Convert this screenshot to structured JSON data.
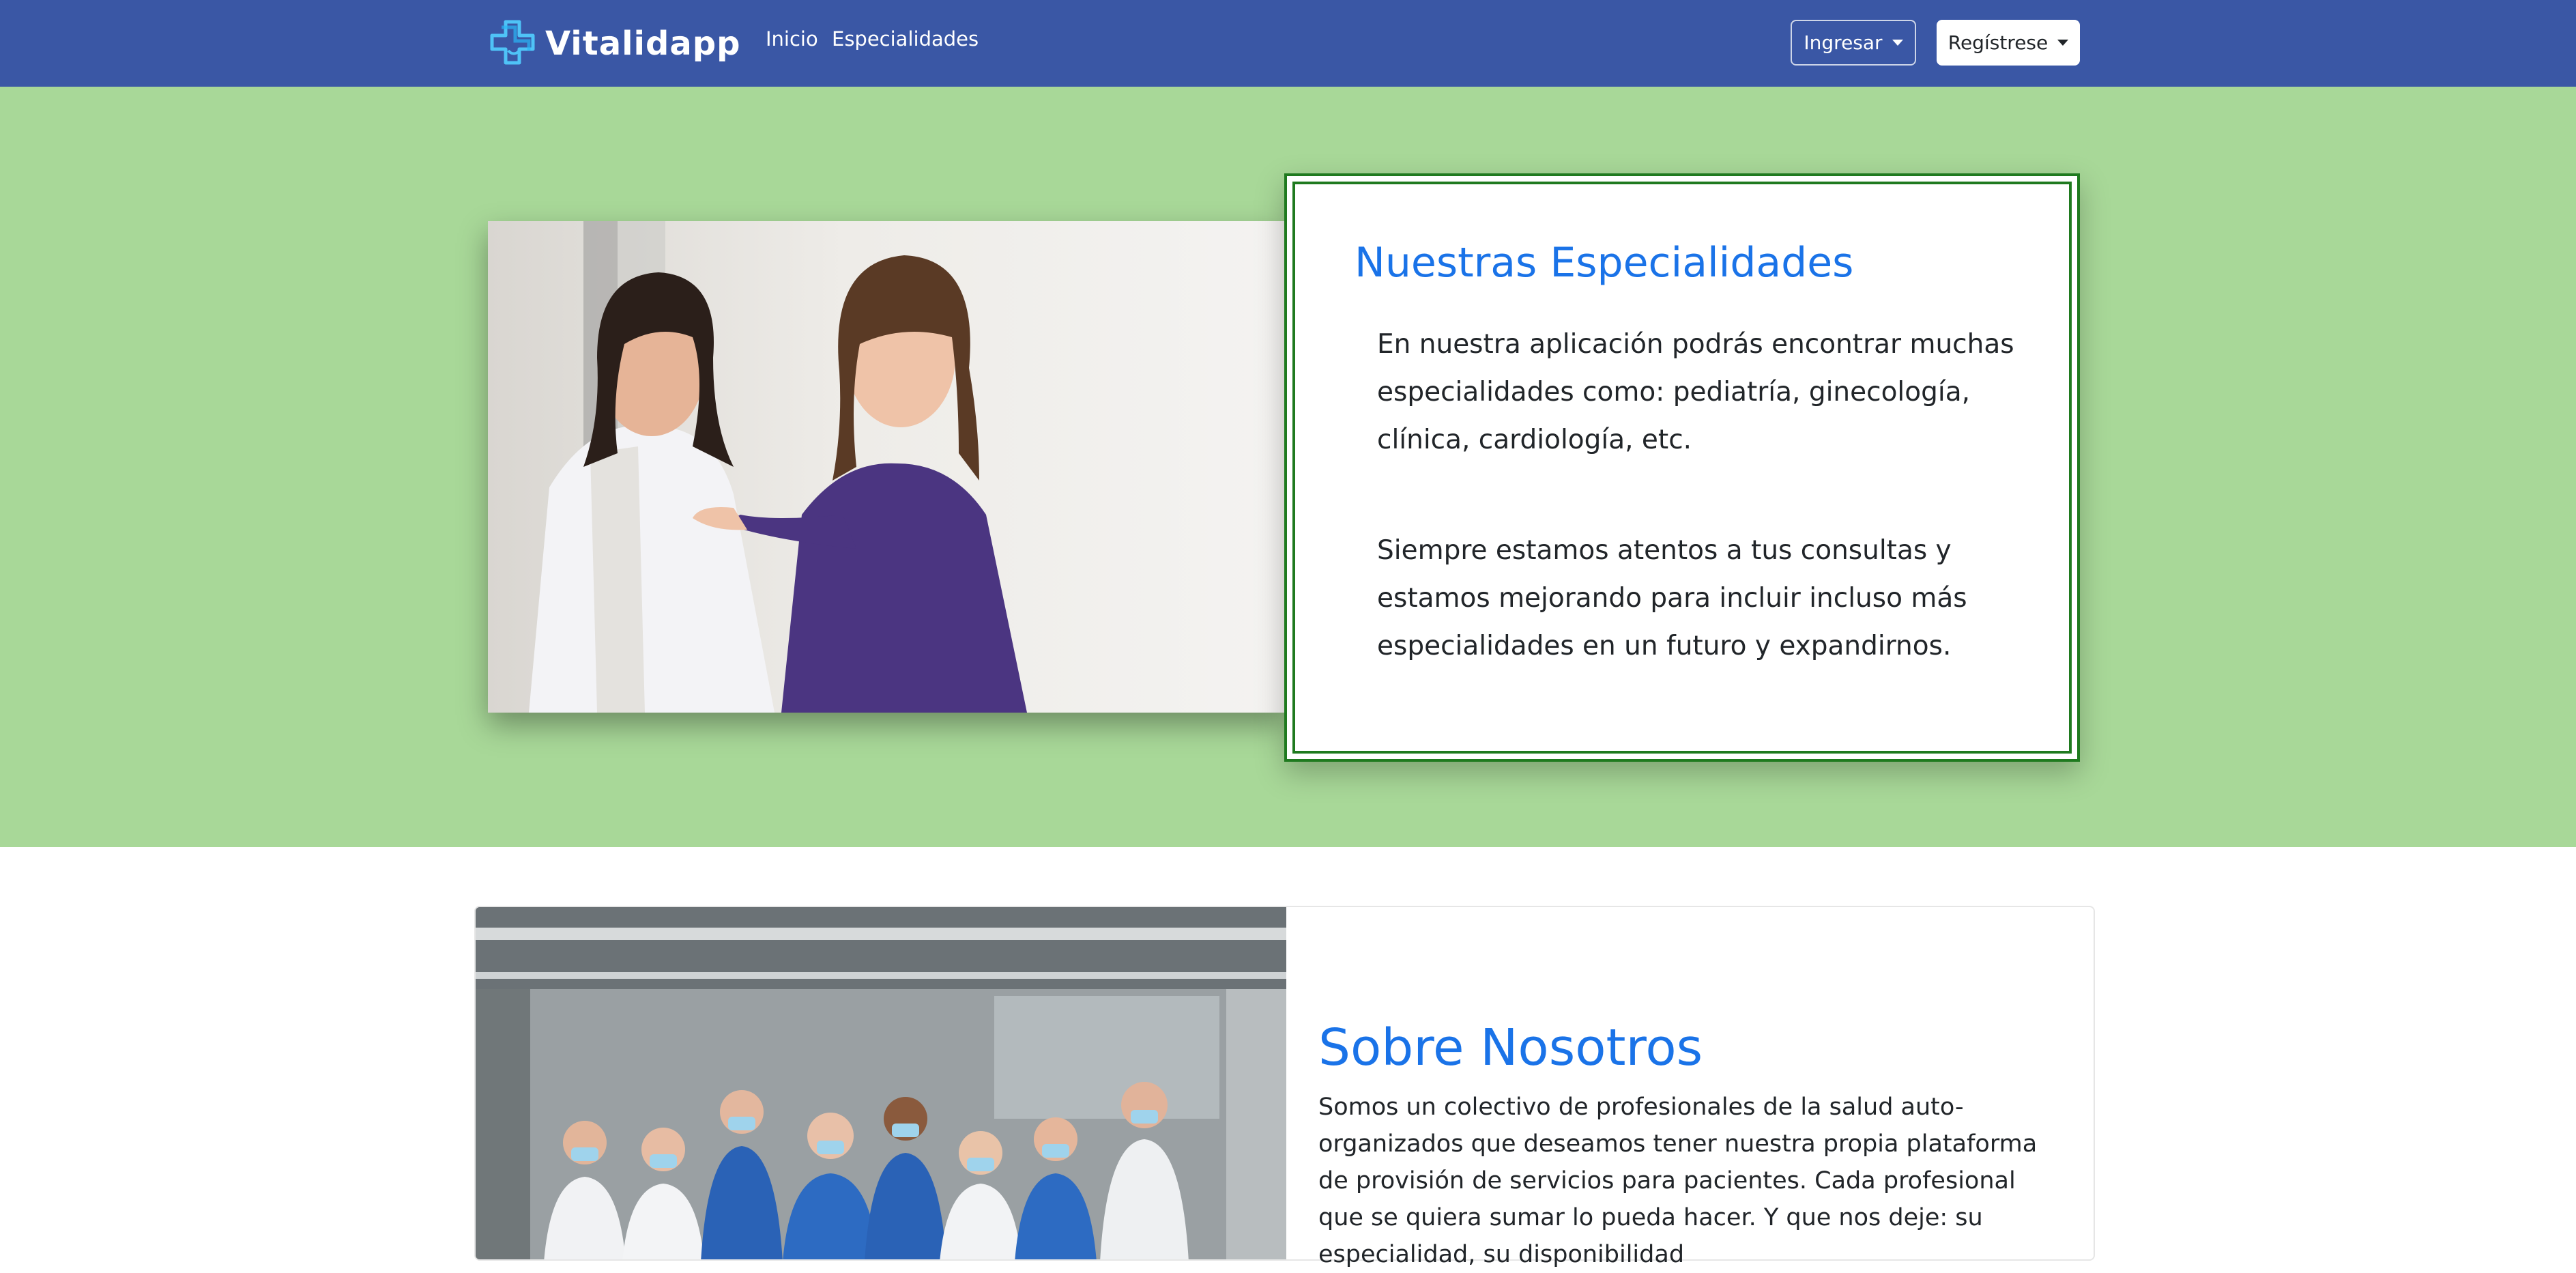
{
  "navbar": {
    "brand": "Vitalidapp",
    "brand_icon": "medical-cross-icon",
    "links": [
      "Inicio",
      "Especialidades"
    ],
    "login_label": "Ingresar",
    "register_label": "Regístrese",
    "bg_color": "#3a57a5"
  },
  "hero": {
    "title": "Nuestras Especialidades",
    "paragraph1": "En nuestra aplicación podrás encontrar muchas especialidades como: pediatría, ginecología, clínica, cardiología, etc.",
    "paragraph2": "Siempre estamos atentos a tus consultas y estamos mejorando para incluir incluso más especialidades en un futuro y expandirnos.",
    "bg_color": "#a8d898",
    "border_color": "#1f7a1f",
    "title_color": "#1a73e8",
    "image": "doctor-and-patient-photo"
  },
  "about": {
    "title": "Sobre Nosotros",
    "paragraph": "Somos un colectivo de profesionales de la salud auto-organizados que deseamos tener nuestra propia plataforma de provisión de servicios para pacientes. Cada profesional que se quiera sumar lo pueda hacer. Y que nos deje: su especialidad, su disponibilidad",
    "image": "medical-team-photo"
  }
}
